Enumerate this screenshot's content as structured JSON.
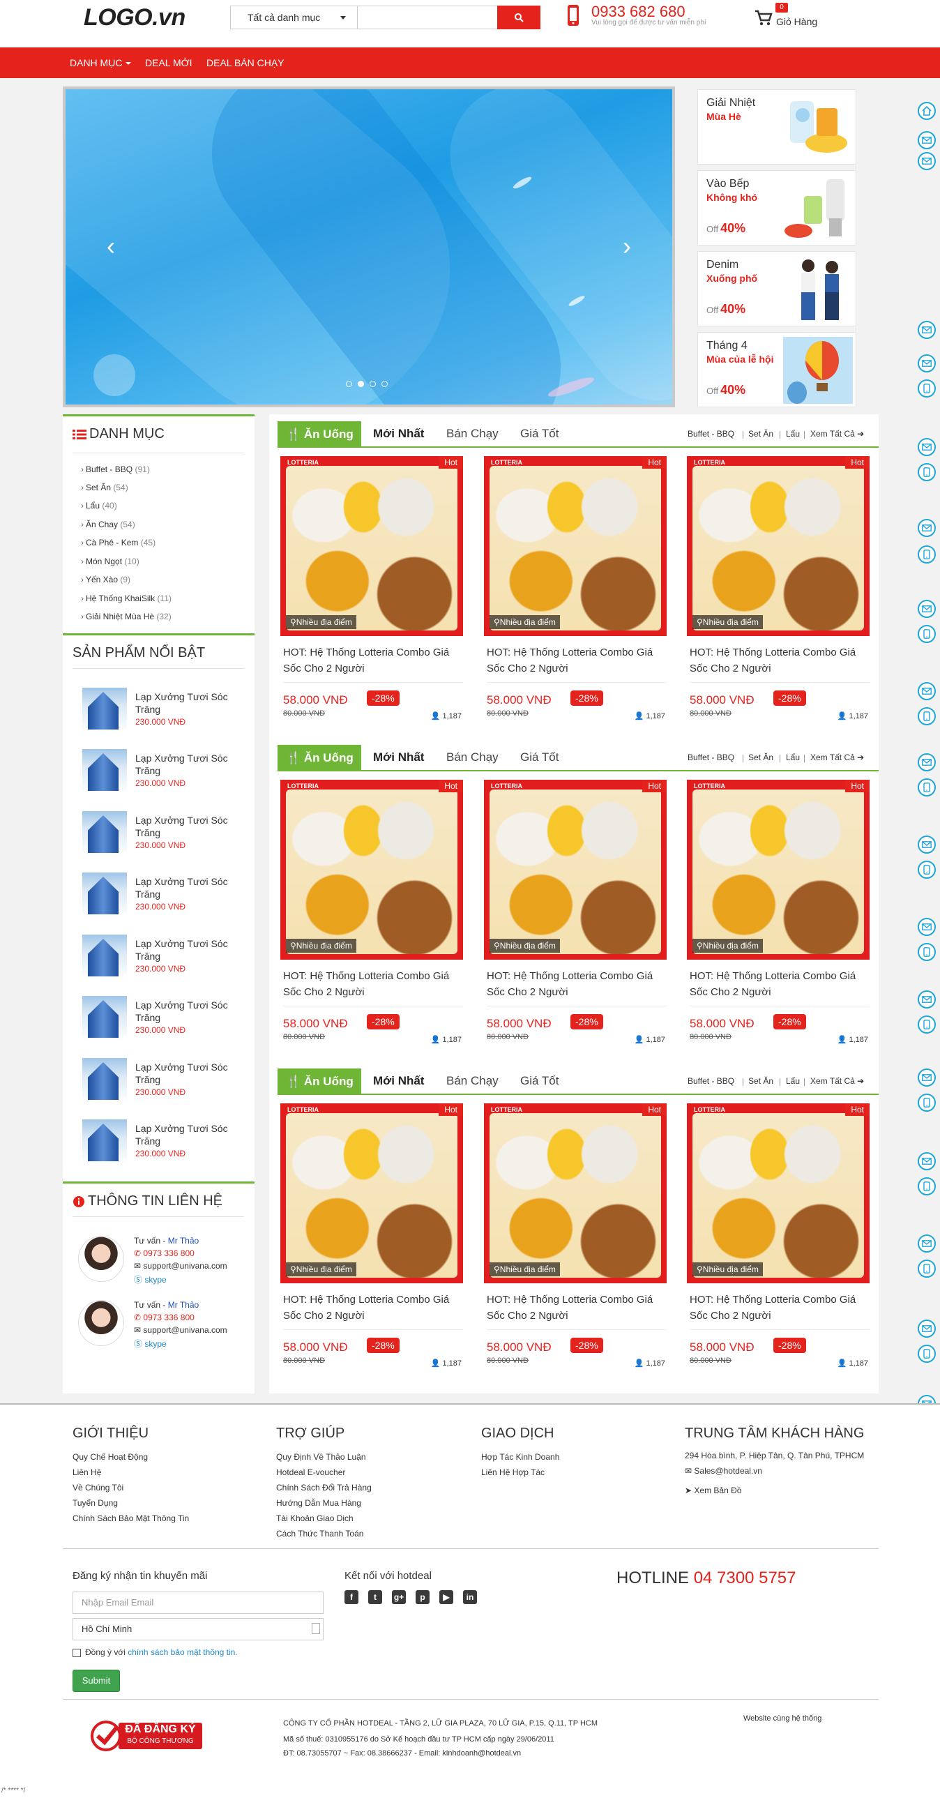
{
  "header": {
    "logo": "LOGO.vn",
    "search_category": "Tất cả danh mục",
    "search_placeholder": "",
    "hotline": "0933 682 680",
    "hotline_note": "Vui lòng gọi để được tư vấn miễn phí",
    "cart_count": "0",
    "cart_label": "Giỏ Hàng"
  },
  "nav": {
    "items": [
      "DANH MỤC",
      "DEAL MỚI",
      "DEAL BÁN CHẠY"
    ]
  },
  "promos": [
    {
      "title": "Giải Nhiệt",
      "sub": "Mùa Hè",
      "off_label": "",
      "off_value": ""
    },
    {
      "title": "Vào Bếp",
      "sub": "Không khó",
      "off_label": "Off",
      "off_value": "40%"
    },
    {
      "title": "Denim",
      "sub": "Xuống phố",
      "off_label": "Off",
      "off_value": "40%"
    },
    {
      "title": "Tháng 4",
      "sub": "Mùa của lễ hội",
      "off_label": "Off",
      "off_value": "40%"
    }
  ],
  "sidebar": {
    "category_title": "DANH MỤC",
    "categories": [
      {
        "name": "Buffet - BBQ",
        "count": "(91)"
      },
      {
        "name": "Set Ăn",
        "count": "(54)"
      },
      {
        "name": "Lẩu",
        "count": "(40)"
      },
      {
        "name": "Ăn Chay",
        "count": "(54)"
      },
      {
        "name": "Cà Phê - Kem",
        "count": "(45)"
      },
      {
        "name": "Món Ngọt",
        "count": "(10)"
      },
      {
        "name": "Yến Xào",
        "count": "(9)"
      },
      {
        "name": "Hệ Thống KhaiSilk",
        "count": "(11)"
      },
      {
        "name": "Giải Nhiệt Mùa Hè",
        "count": "(32)"
      }
    ],
    "featured_title": "SẢN PHẨM NỔI BẬT",
    "featured": [
      {
        "name": "Lạp Xưởng Tươi Sóc Trăng",
        "price": "230.000 VNĐ"
      },
      {
        "name": "Lạp Xưởng Tươi Sóc Trăng",
        "price": "230.000 VNĐ"
      },
      {
        "name": "Lạp Xưởng Tươi Sóc Trăng",
        "price": "230.000 VNĐ"
      },
      {
        "name": "Lạp Xưởng Tươi Sóc Trăng",
        "price": "230.000 VNĐ"
      },
      {
        "name": "Lạp Xưởng Tươi Sóc Trăng",
        "price": "230.000 VNĐ"
      },
      {
        "name": "Lạp Xưởng Tươi Sóc Trăng",
        "price": "230.000 VNĐ"
      },
      {
        "name": "Lạp Xưởng Tươi Sóc Trăng",
        "price": "230.000 VNĐ"
      },
      {
        "name": "Lạp Xưởng Tươi Sóc Trăng",
        "price": "230.000 VNĐ"
      }
    ],
    "contact_title": "THÔNG TIN LIÊN HỆ",
    "contacts": [
      {
        "role": "Tư vấn - ",
        "name": "Mr Thảo",
        "phone": "0973 336 800",
        "email": "support@univana.com",
        "skype": "skype"
      },
      {
        "role": "Tư vấn - ",
        "name": "Mr Thảo",
        "phone": "0973 336 800",
        "email": "support@univana.com",
        "skype": "skype"
      }
    ]
  },
  "sections": [
    {
      "tag": "Ăn Uống",
      "tabs": [
        "Mới Nhất",
        "Bán Chạy",
        "Giá Tốt"
      ],
      "links": [
        "Buffet - BBQ",
        "Set Ăn",
        "Lẩu",
        "Xem Tất Cả"
      ],
      "products": [
        {
          "badge": "Hot",
          "location": "Nhiều địa điểm",
          "title": "HOT: Hệ Thống Lotteria Combo Giá Sốc Cho 2 Người",
          "price": "58.000 VNĐ",
          "discount": "-28%",
          "old_price": "80.000 VNĐ",
          "views": "1,187"
        },
        {
          "badge": "Hot",
          "location": "Nhiều địa điểm",
          "title": "HOT: Hệ Thống Lotteria Combo Giá Sốc Cho 2 Người",
          "price": "58.000 VNĐ",
          "discount": "-28%",
          "old_price": "80.000 VNĐ",
          "views": "1,187"
        },
        {
          "badge": "Hot",
          "location": "Nhiều địa điểm",
          "title": "HOT: Hệ Thống Lotteria Combo Giá Sốc Cho 2 Người",
          "price": "58.000 VNĐ",
          "discount": "-28%",
          "old_price": "80.000 VNĐ",
          "views": "1,187"
        }
      ]
    },
    {
      "tag": "Ăn Uống",
      "tabs": [
        "Mới Nhất",
        "Bán Chạy",
        "Giá Tốt"
      ],
      "links": [
        "Buffet - BBQ",
        "Set Ăn",
        "Lẩu",
        "Xem Tất Cả"
      ],
      "products": [
        {
          "badge": "Hot",
          "location": "Nhiều địa điểm",
          "title": "HOT: Hệ Thống Lotteria Combo Giá Sốc Cho 2 Người",
          "price": "58.000 VNĐ",
          "discount": "-28%",
          "old_price": "80.000 VNĐ",
          "views": "1,187"
        },
        {
          "badge": "Hot",
          "location": "Nhiều địa điểm",
          "title": "HOT: Hệ Thống Lotteria Combo Giá Sốc Cho 2 Người",
          "price": "58.000 VNĐ",
          "discount": "-28%",
          "old_price": "80.000 VNĐ",
          "views": "1,187"
        },
        {
          "badge": "Hot",
          "location": "Nhiều địa điểm",
          "title": "HOT: Hệ Thống Lotteria Combo Giá Sốc Cho 2 Người",
          "price": "58.000 VNĐ",
          "discount": "-28%",
          "old_price": "80.000 VNĐ",
          "views": "1,187"
        }
      ]
    },
    {
      "tag": "Ăn Uống",
      "tabs": [
        "Mới Nhất",
        "Bán Chạy",
        "Giá Tốt"
      ],
      "links": [
        "Buffet - BBQ",
        "Set Ăn",
        "Lẩu",
        "Xem Tất Cả"
      ],
      "products": [
        {
          "badge": "Hot",
          "location": "Nhiều địa điểm",
          "title": "HOT: Hệ Thống Lotteria Combo Giá Sốc Cho 2 Người",
          "price": "58.000 VNĐ",
          "discount": "-28%",
          "old_price": "80.000 VNĐ",
          "views": "1,187"
        },
        {
          "badge": "Hot",
          "location": "Nhiều địa điểm",
          "title": "HOT: Hệ Thống Lotteria Combo Giá Sốc Cho 2 Người",
          "price": "58.000 VNĐ",
          "discount": "-28%",
          "old_price": "80.000 VNĐ",
          "views": "1,187"
        },
        {
          "badge": "Hot",
          "location": "Nhiều địa điểm",
          "title": "HOT: Hệ Thống Lotteria Combo Giá Sốc Cho 2 Người",
          "price": "58.000 VNĐ",
          "discount": "-28%",
          "old_price": "80.000 VNĐ",
          "views": "1,187"
        }
      ]
    }
  ],
  "footer": {
    "col1": {
      "title": "GIỚI THIỆU",
      "links": [
        "Quy Chế Hoạt Động",
        "Liên Hệ",
        "Về Chúng Tôi",
        "Tuyển Dụng",
        "Chính Sách Bảo Mật Thông Tin"
      ]
    },
    "col2": {
      "title": "TRỢ GIÚP",
      "links": [
        "Quy Định Về Thảo Luận",
        "Hotdeal E-voucher",
        "Chính Sách Đổi Trả Hàng",
        "Hướng Dẫn Mua Hàng",
        "Tài Khoản Giao Dịch",
        "Cách Thức Thanh Toán"
      ]
    },
    "col3": {
      "title": "GIAO DỊCH",
      "links": [
        "Hợp Tác Kinh Doanh",
        "Liên Hệ Hợp Tác"
      ]
    },
    "col4": {
      "title": "TRUNG TÂM KHÁCH HÀNG",
      "address": "294 Hòa bình, P. Hiệp Tân, Q. Tân Phú, TPHCM",
      "email": "Sales@hotdeal.vn",
      "map": "Xem Bản Đồ"
    },
    "newsletter_title": "Đăng ký nhận tin khuyến mãi",
    "email_placeholder": "Nhập Email Email",
    "city": "Hồ Chí Minh",
    "agree_text": "Đồng ý với",
    "agree_link": "chính sách bảo mật thông tin.",
    "submit": "Submit",
    "social_title": "Kết nối với hotdeal",
    "hotline_label": "HOTLINE",
    "hotline_number": "04 7300 5757",
    "stamp_line1": "ĐÃ ĐĂNG KÝ",
    "stamp_line2": "BỘ CÔNG THƯƠNG",
    "company": "CÔNG TY CỔ PHẦN HOTDEAL - TẦNG 2, LỮ GIA PLAZA, 70 LỮ GIA, P.15, Q.11, TP HCM",
    "tax": "Mã số thuế: 0310955176 do Sở Kế hoạch đầu tư TP HCM cấp ngày 29/06/2011",
    "phones": "ĐT: 08.73055707 ~ Fax: 08.38666237 - Email: kinhdoanh@hotdeal.vn",
    "partner": "Website cùng hệ thống",
    "corner": "/* **** */"
  },
  "colors": {
    "accent": "#e5231d",
    "green": "#6fb637",
    "icon_blue": "#1ea6d8"
  }
}
